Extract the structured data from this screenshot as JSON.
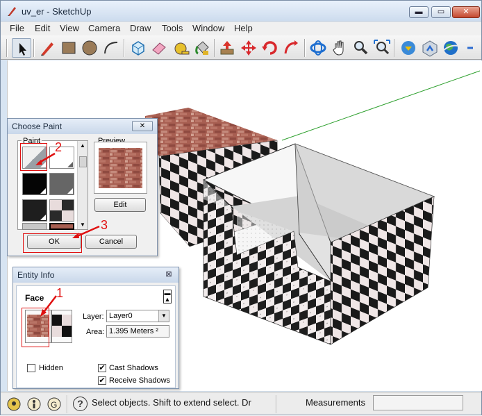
{
  "window": {
    "title": "uv_er - SketchUp",
    "controls": {
      "minimize": "▬",
      "maximize": "▭",
      "close": "✕"
    }
  },
  "menubar": {
    "items": [
      "File",
      "Edit",
      "View",
      "Camera",
      "Draw",
      "Tools",
      "Window",
      "Help"
    ]
  },
  "toolbar": {
    "tools": [
      "select-arrow-icon",
      "pencil-line-icon",
      "rectangle-icon",
      "circle-icon",
      "arc-icon",
      "make-component-icon",
      "eraser-icon",
      "tape-measure-icon",
      "paint-bucket-icon",
      "push-pull-icon",
      "move-icon",
      "rotate-icon",
      "follow-me-icon",
      "orbit-icon",
      "pan-hand-icon",
      "zoom-icon",
      "zoom-extents-icon",
      "3d-warehouse-icon",
      "share-model-icon",
      "google-earth-icon"
    ]
  },
  "choose_paint": {
    "title": "Choose Paint",
    "close": "✕",
    "paint_label": "Paint",
    "preview_label": "Preview",
    "edit_label": "Edit",
    "ok_label": "OK",
    "cancel_label": "Cancel",
    "swatches": [
      "default-material",
      "white",
      "black",
      "dark-gray",
      "charcoal",
      "checker-texture",
      "gray-pattern",
      "brick-texture"
    ]
  },
  "entity_info": {
    "title": "Entity Info",
    "close": "⊠",
    "entity_type": "Face",
    "layer_label": "Layer:",
    "layer_value": "Layer0",
    "area_label": "Area:",
    "area_value": "1.395 Meters ²",
    "hidden_label": "Hidden",
    "hidden_checked": false,
    "cast_shadows_label": "Cast Shadows",
    "cast_shadows_checked": true,
    "receive_shadows_label": "Receive Shadows",
    "receive_shadows_checked": true
  },
  "annotations": {
    "n1": "1",
    "n2": "2",
    "n3": "3"
  },
  "statusbar": {
    "icons": [
      "geo-location-icon",
      "credits-icon",
      "google-signin-icon"
    ],
    "help_icon": "?",
    "status_text": "Select objects. Shift to extend select. Dr",
    "measurements_label": "Measurements",
    "measurements_value": ""
  },
  "colors": {
    "annotation": "#e01010",
    "axis_green": "#2ea02e",
    "axis_red": "#c03030",
    "brick": "#b06a5c"
  }
}
